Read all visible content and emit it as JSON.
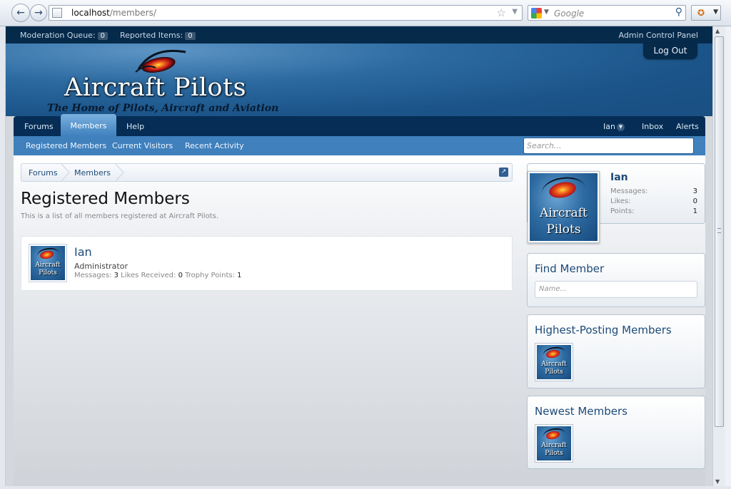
{
  "browser": {
    "url_host": "localhost",
    "url_path": "/members/",
    "search_placeholder": "Google"
  },
  "moderator_bar": {
    "moderation_queue_label": "Moderation Queue:",
    "moderation_queue_count": "0",
    "reported_items_label": "Reported Items:",
    "reported_items_count": "0",
    "admin_link": "Admin Control Panel"
  },
  "header": {
    "logout_label": "Log Out",
    "site_title": "Aircraft Pilots",
    "tagline": "The Home of Pilots, Aircraft and Aviation"
  },
  "nav": {
    "tabs": [
      "Forums",
      "Members",
      "Help"
    ],
    "active_tab": "Members",
    "user": "Ian",
    "inbox": "Inbox",
    "alerts": "Alerts"
  },
  "subnav": {
    "items": [
      "Registered Members",
      "Current Visitors",
      "Recent Activity"
    ],
    "search_placeholder": "Search..."
  },
  "breadcrumb": [
    "Forums",
    "Members"
  ],
  "page": {
    "title": "Registered Members",
    "description": "This is a list of all members registered at Aircraft Pilots."
  },
  "members": [
    {
      "name": "Ian",
      "role": "Administrator",
      "messages_label": "Messages:",
      "messages": "3",
      "likes_label": "Likes Received:",
      "likes": "0",
      "trophy_label": "Trophy Points:",
      "trophy": "1"
    }
  ],
  "avatar_text": {
    "line1": "Aircraft",
    "line2": "Pilots"
  },
  "sidebar": {
    "visitor": {
      "name": "Ian",
      "stats": [
        {
          "label": "Messages:",
          "value": "3"
        },
        {
          "label": "Likes:",
          "value": "0"
        },
        {
          "label": "Points:",
          "value": "1"
        }
      ]
    },
    "find_member_title": "Find Member",
    "find_member_placeholder": "Name...",
    "highest_posting_title": "Highest-Posting Members",
    "newest_title": "Newest Members"
  },
  "colors": {
    "mod_bar": "#062a4a",
    "nav_dark": "#052d55",
    "nav_active": "#3f80bd",
    "link": "#1d4a78"
  }
}
